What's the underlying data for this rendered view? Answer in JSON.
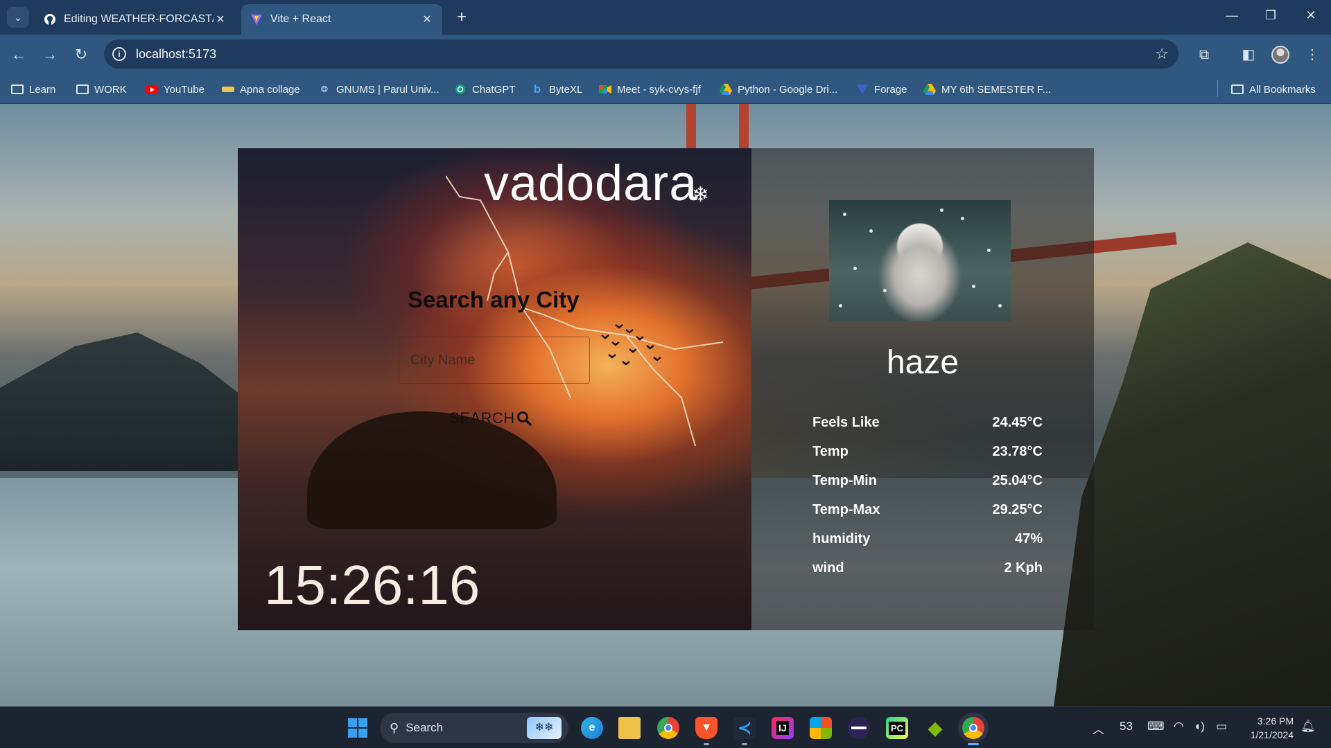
{
  "browser": {
    "tabs": [
      {
        "title": "Editing WEATHER-FORCAST/RE",
        "active": false,
        "icon": "github-icon"
      },
      {
        "title": "Vite + React",
        "active": true,
        "icon": "vite-icon"
      }
    ],
    "url": "localhost:5173",
    "bookmarks": [
      {
        "label": "Learn",
        "icon": "folder-icon"
      },
      {
        "label": "WORK",
        "icon": "folder-icon"
      },
      {
        "label": "YouTube",
        "icon": "youtube-icon"
      },
      {
        "label": "Apna collage",
        "icon": "apna-icon"
      },
      {
        "label": "GNUMS | Parul Univ...",
        "icon": "globe-icon"
      },
      {
        "label": "ChatGPT",
        "icon": "chatgpt-icon"
      },
      {
        "label": "ByteXL",
        "icon": "bytexl-icon"
      },
      {
        "label": "Meet - syk-cvys-fjf",
        "icon": "meet-icon"
      },
      {
        "label": "Python - Google Dri...",
        "icon": "drive-icon"
      },
      {
        "label": "Forage",
        "icon": "forage-icon"
      },
      {
        "label": "MY 6th SEMESTER F...",
        "icon": "drive-icon"
      }
    ],
    "all_bookmarks": "All Bookmarks"
  },
  "app": {
    "city": "vadodara",
    "weather_symbol": "❄",
    "search_heading": "Search any City",
    "input_placeholder": "City Name",
    "search_button": "SEARCH",
    "clock": "15:26:16",
    "condition": "haze",
    "stats": [
      {
        "label": "Feels Like",
        "value": "24.45°C"
      },
      {
        "label": "Temp",
        "value": "23.78°C"
      },
      {
        "label": "Temp-Min",
        "value": "25.04°C"
      },
      {
        "label": "Temp-Max",
        "value": "29.25°C"
      },
      {
        "label": "humidity",
        "value": "47%"
      },
      {
        "label": "wind",
        "value": "2 Kph"
      }
    ]
  },
  "taskbar": {
    "search_placeholder": "Search",
    "tray_temp": "53",
    "time": "3:26 PM",
    "date": "1/21/2024"
  },
  "colors": {
    "tab_bar": "#1e3a5c",
    "toolbar": "#2f5780",
    "taskbar": "#1c2432"
  }
}
